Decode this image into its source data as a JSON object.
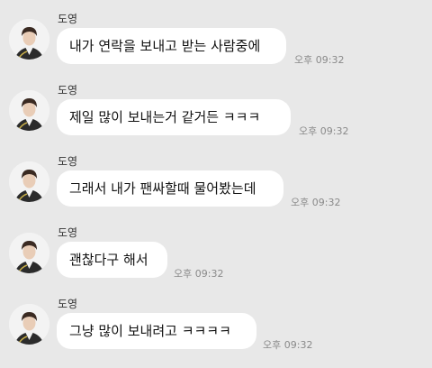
{
  "messages": [
    {
      "sender": "도영",
      "text": "내가 연락을 보내고 받는 사람중에",
      "time": "오후 09:32"
    },
    {
      "sender": "도영",
      "text": "제일 많이 보내는거 같거든 ㅋㅋㅋ",
      "time": "오후 09:32"
    },
    {
      "sender": "도영",
      "text": "그래서 내가 팬싸할때 물어봤는데",
      "time": "오후 09:32"
    },
    {
      "sender": "도영",
      "text": "괜찮다구 해서",
      "time": "오후 09:32"
    },
    {
      "sender": "도영",
      "text": "그냥 많이 보내려고 ㅋㅋㅋㅋ",
      "time": "오후 09:32"
    }
  ],
  "colors": {
    "background": "#e8e8e8",
    "bubble": "#ffffff",
    "time": "#8a8a8a"
  },
  "icons": {
    "avatar": "profile-photo-avatar"
  }
}
